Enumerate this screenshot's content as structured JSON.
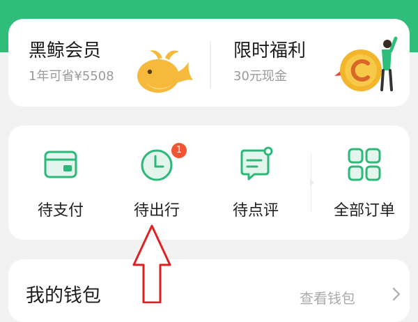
{
  "colors": {
    "brand_green": "#2fbd7a",
    "icon_green": "#2bb878",
    "badge_red": "#f15533",
    "annotation_arrow": "#e02020"
  },
  "membership": {
    "title": "黑鲸会员",
    "subtitle": "1年可省¥5508",
    "icon": "whale-icon"
  },
  "welfare": {
    "title": "限时福利",
    "subtitle": "30元现金",
    "icon": "coin-c-icon"
  },
  "orders": {
    "items": [
      {
        "label": "待支付",
        "icon": "wallet-icon"
      },
      {
        "label": "待出行",
        "icon": "clock-icon",
        "badge": "1"
      },
      {
        "label": "待点评",
        "icon": "comment-icon"
      },
      {
        "label": "全部订单",
        "icon": "grid-icon"
      }
    ]
  },
  "wallet": {
    "title": "我的钱包",
    "link": "查看钱包"
  },
  "annotation": {
    "type": "arrow-up",
    "points_to": "待出行"
  }
}
